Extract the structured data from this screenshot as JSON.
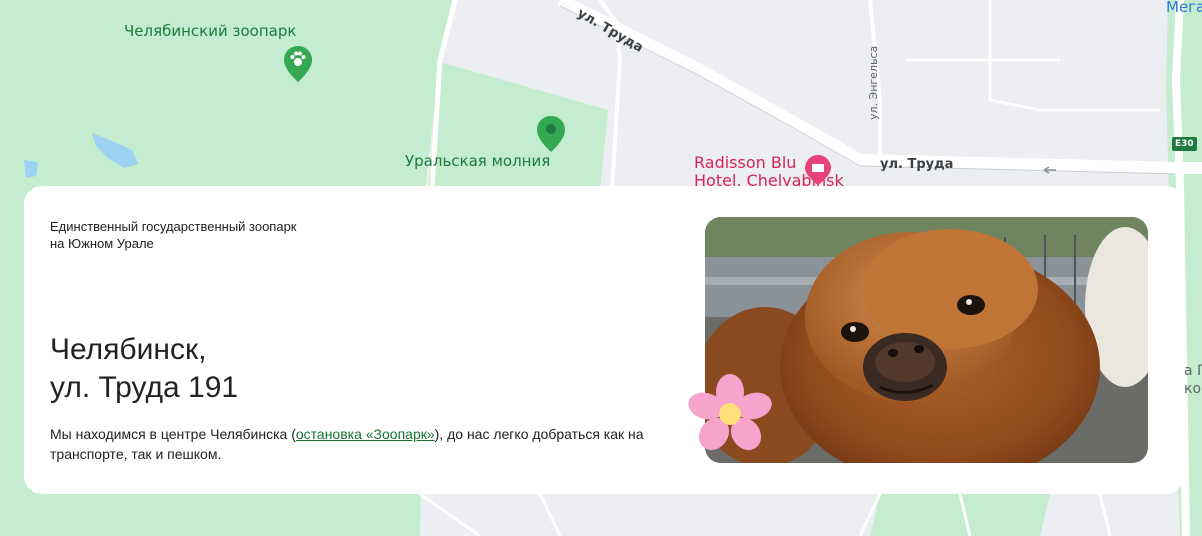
{
  "map": {
    "labels": {
      "zoo": "Челябинский зоопарк",
      "molnia": "Уральская молния",
      "radisson_line1": "Radisson Blu",
      "radisson_line2": "Hotel, Chelyabinsk",
      "street_truda_top": "ул. Труда",
      "street_truda_right": "ул. Труда",
      "street_engelsa": "ул. Энгельса",
      "mega": "Мега",
      "route_badge": "E30",
      "edge_text_1": "а П",
      "edge_text_2": "ко"
    },
    "colors": {
      "park": "#c4eccf",
      "water": "#9dd2f2",
      "road": "#ffffff",
      "background": "#eceef1",
      "poi_green": "#34a853",
      "poi_pink": "#d6245c"
    }
  },
  "card": {
    "tagline": "Единственный государственный зоопарк на Южном Урале",
    "address_line1": "Челябинск,",
    "address_line2": "ул. Труда 191",
    "description_before": "Мы находимся в центре Челябинска (",
    "description_link": "остановка «Зоопарк»",
    "description_after": "), до нас легко добраться как на транспорте, так и пешком.",
    "photo_subject": "alpaca-photo",
    "decoration": "flower-icon"
  }
}
